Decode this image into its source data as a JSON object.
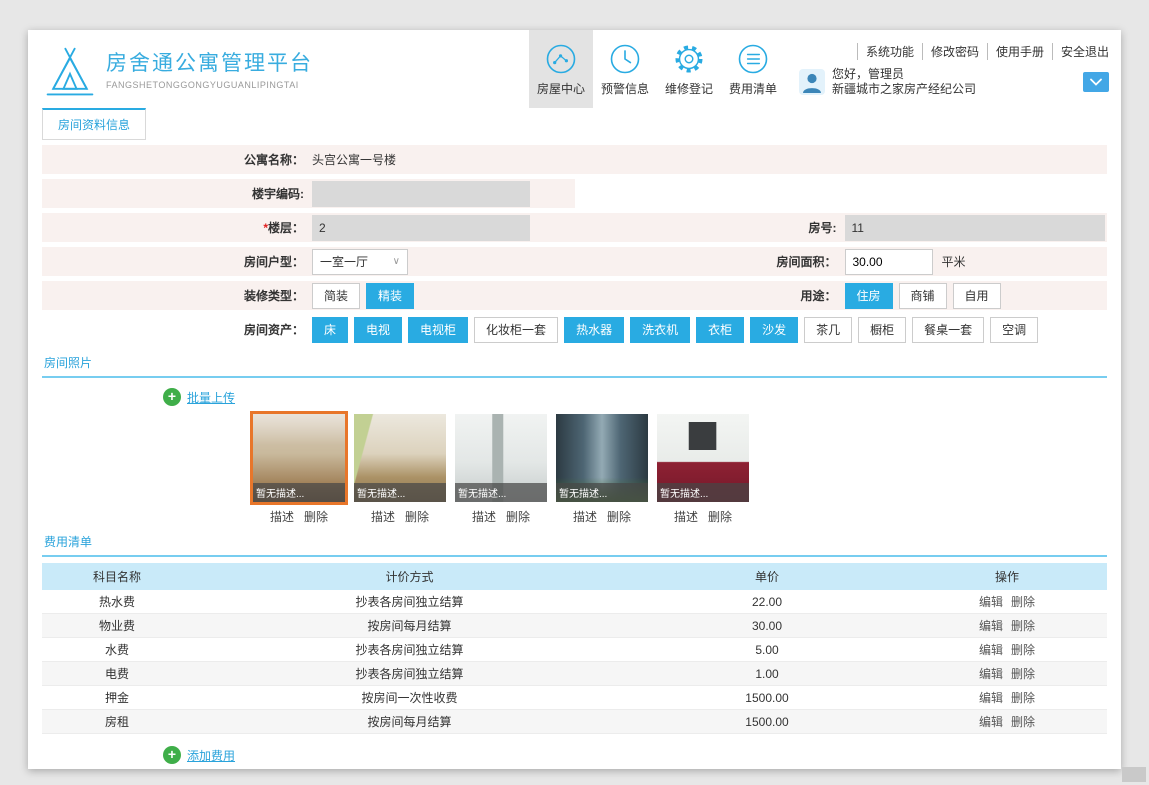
{
  "theme": {
    "accent_blue": "#29abe2",
    "form_pink": "#f9f1ef",
    "input_gray": "#d9d9d9",
    "table_header_blue": "#c9eaf9",
    "selected_photo_orange": "#e8762a",
    "upload_green": "#3fae49"
  },
  "header": {
    "title": "房舍通公寓管理平台",
    "subtitle": "FANGSHETONGGONGYUGUANLIPINGTAI",
    "nav": [
      {
        "label": "房屋中心",
        "active": true
      },
      {
        "label": "预警信息",
        "active": false
      },
      {
        "label": "维修登记",
        "active": false
      },
      {
        "label": "费用清单",
        "active": false
      }
    ],
    "links": [
      "系统功能",
      "修改密码",
      "使用手册",
      "安全退出"
    ],
    "user": {
      "greeting": "您好，管理员",
      "company": "新疆城市之家房产经纪公司"
    }
  },
  "tabs": {
    "room_info": "房间资料信息"
  },
  "form": {
    "apartment_name": {
      "label": "公寓名称：",
      "value": "头宫公寓一号楼"
    },
    "building_code": {
      "label": "楼宇编码:",
      "value": ""
    },
    "floor": {
      "label": "楼层：",
      "required_mark": "*",
      "value": "2"
    },
    "room_no": {
      "label": "房号:",
      "value": "11"
    },
    "room_type": {
      "label": "房间户型：",
      "value": "一室一厅"
    },
    "area": {
      "label": "房间面积：",
      "value": "30.00",
      "unit": "平米"
    },
    "decoration": {
      "label": "装修类型：",
      "options": [
        {
          "label": "简装",
          "selected": false
        },
        {
          "label": "精装",
          "selected": true
        }
      ]
    },
    "usage": {
      "label": "用途：",
      "options": [
        {
          "label": "住房",
          "selected": true
        },
        {
          "label": "商铺",
          "selected": false
        },
        {
          "label": "自用",
          "selected": false
        }
      ]
    },
    "assets": {
      "label": "房间资产：",
      "options": [
        {
          "label": "床",
          "selected": true
        },
        {
          "label": "电视",
          "selected": true
        },
        {
          "label": "电视柜",
          "selected": true
        },
        {
          "label": "化妆柜一套",
          "selected": false
        },
        {
          "label": "热水器",
          "selected": true
        },
        {
          "label": "洗衣机",
          "selected": true
        },
        {
          "label": "衣柜",
          "selected": true
        },
        {
          "label": "沙发",
          "selected": true
        },
        {
          "label": "茶几",
          "selected": false
        },
        {
          "label": "橱柜",
          "selected": false
        },
        {
          "label": "餐桌一套",
          "selected": false
        },
        {
          "label": "空调",
          "selected": false
        }
      ]
    }
  },
  "photos": {
    "section_title": "房间照片",
    "upload_label": "批量上传",
    "desc_label": "描述",
    "delete_label": "删除",
    "items": [
      {
        "caption": "暂无描述...",
        "selected": true
      },
      {
        "caption": "暂无描述...",
        "selected": false
      },
      {
        "caption": "暂无描述...",
        "selected": false
      },
      {
        "caption": "暂无描述...",
        "selected": false
      },
      {
        "caption": "暂无描述...",
        "selected": false
      }
    ]
  },
  "fees": {
    "section_title": "费用清单",
    "add_label": "添加费用",
    "edit_label": "编辑",
    "delete_label": "删除",
    "headers": [
      "科目名称",
      "计价方式",
      "单价",
      "操作"
    ],
    "rows": [
      {
        "name": "热水费",
        "method": "抄表各房间独立结算",
        "price": "22.00"
      },
      {
        "name": "物业费",
        "method": "按房间每月结算",
        "price": "30.00"
      },
      {
        "name": "水费",
        "method": "抄表各房间独立结算",
        "price": "5.00"
      },
      {
        "name": "电费",
        "method": "抄表各房间独立结算",
        "price": "1.00"
      },
      {
        "name": "押金",
        "method": "按房间一次性收费",
        "price": "1500.00"
      },
      {
        "name": "房租",
        "method": "按房间每月结算",
        "price": "1500.00"
      }
    ]
  }
}
